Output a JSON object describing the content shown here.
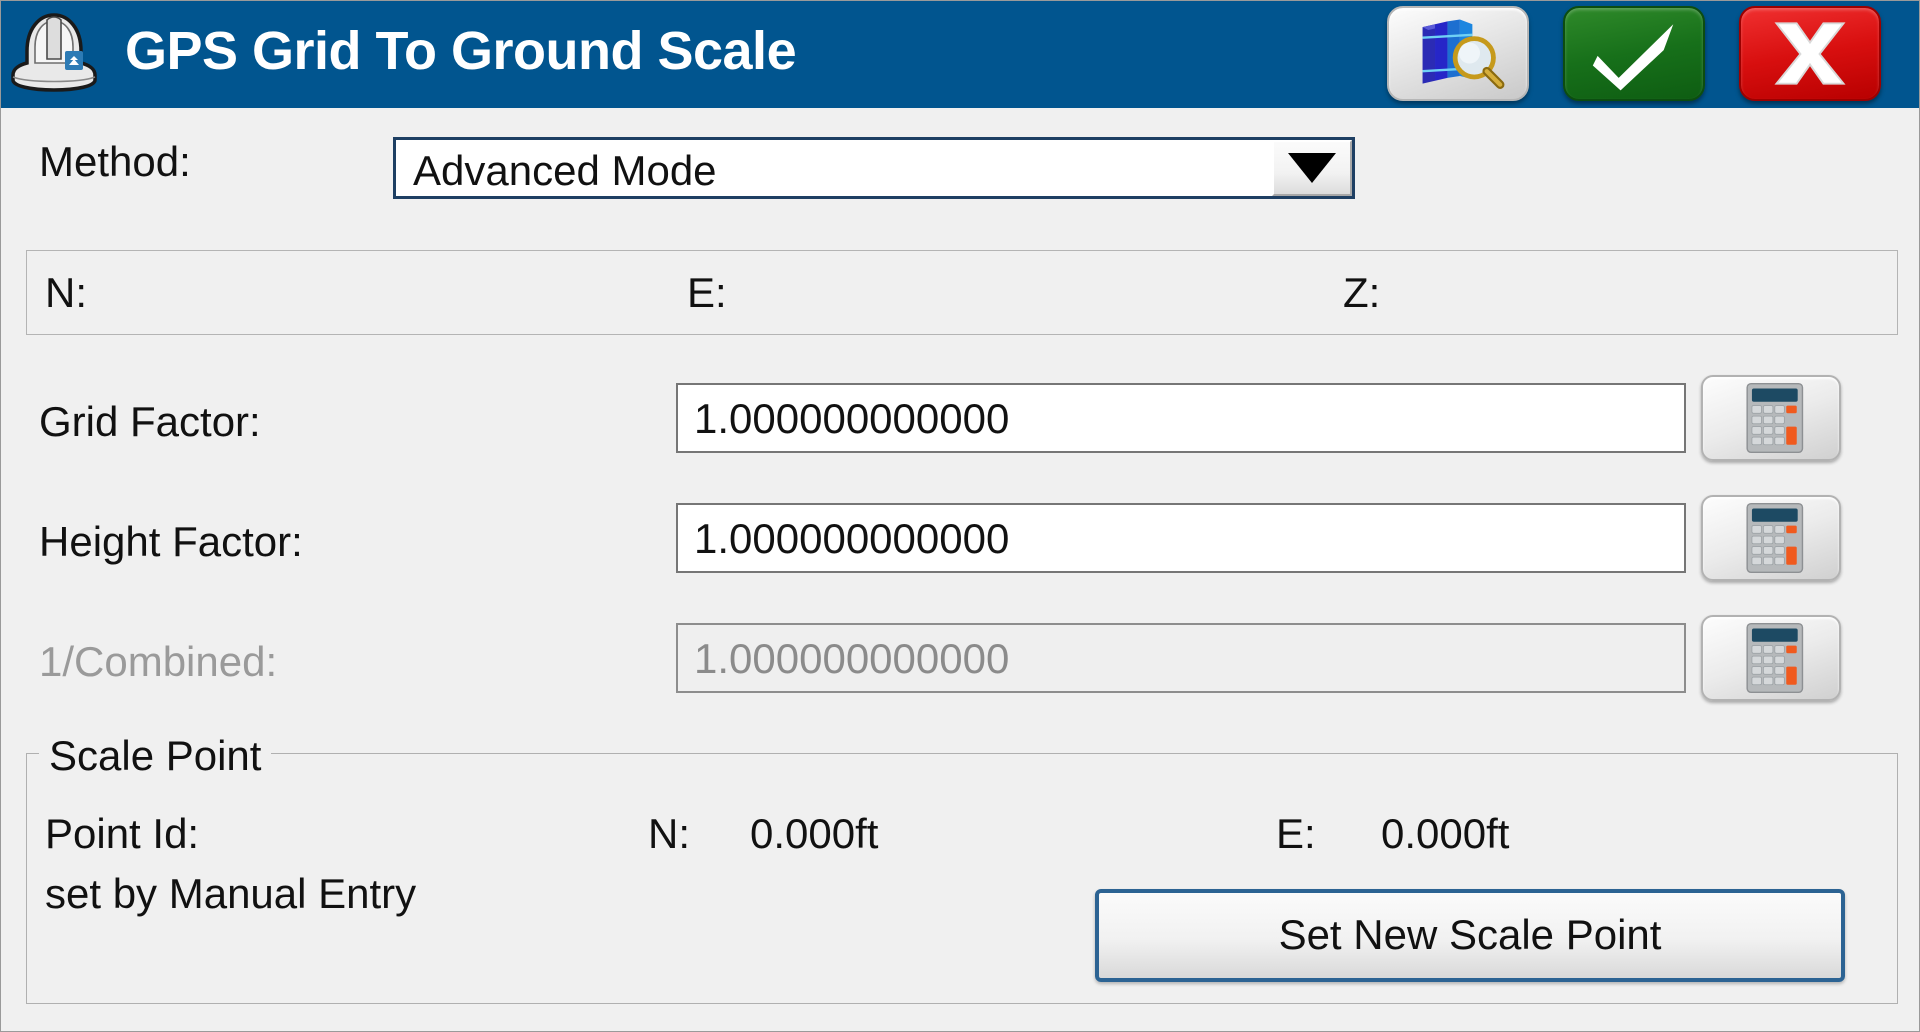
{
  "window": {
    "title": "GPS Grid To Ground Scale",
    "hardhat_icon": "hard-hat-icon",
    "buttons": [
      {
        "name": "help-button",
        "icon": "books-magnifier-icon"
      },
      {
        "name": "accept-button",
        "icon": "check-mark-icon"
      },
      {
        "name": "cancel-button",
        "icon": "x-mark-icon"
      }
    ]
  },
  "method": {
    "label": "Method:",
    "value": "Advanced Mode",
    "options": [
      "Advanced Mode"
    ],
    "arrow_icon": "chevron-down-icon"
  },
  "coords": {
    "n_label": "N:",
    "e_label": "E:",
    "z_label": "Z:",
    "n_value": "",
    "e_value": "",
    "z_value": ""
  },
  "factors": [
    {
      "name": "grid-factor",
      "label": "Grid Factor:",
      "value": "1.000000000000",
      "disabled": false,
      "calc_icon": "calculator-icon"
    },
    {
      "name": "height-factor",
      "label": "Height Factor:",
      "value": "1.000000000000",
      "disabled": false,
      "calc_icon": "calculator-icon"
    },
    {
      "name": "one-over-combined",
      "label": "1/Combined:",
      "value": "1.000000000000",
      "disabled": true,
      "calc_icon": "calculator-icon"
    }
  ],
  "scale_point": {
    "legend": "Scale Point",
    "point_id_label": "Point Id:",
    "point_id_value": "",
    "set_by": "set by Manual Entry",
    "n_label": "N:",
    "n_value": "0.000ft",
    "e_label": "E:",
    "e_value": "0.000ft",
    "set_new_label": "Set New Scale Point"
  },
  "colors": {
    "titlebar": "#01558f",
    "background": "#f0f0f0",
    "accept_green": "#17701a",
    "cancel_red": "#d80f0f",
    "focus_border": "#2c6393",
    "disabled_text": "#8b8b8b"
  }
}
